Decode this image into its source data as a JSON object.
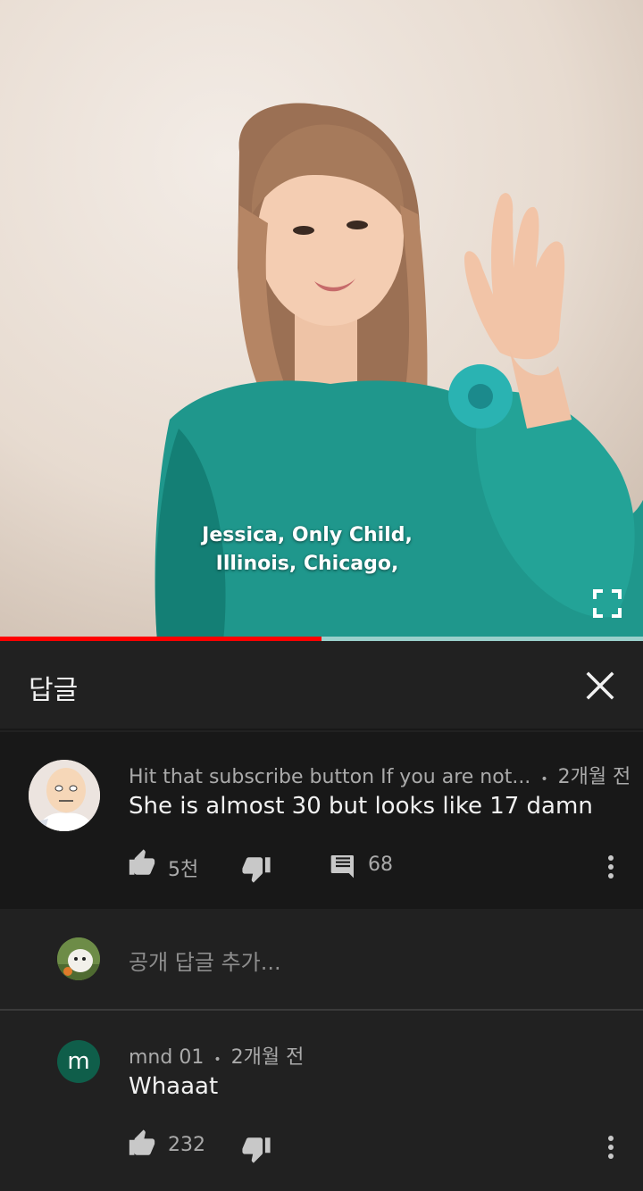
{
  "video": {
    "subtitle_lines": [
      "Jessica, Only Child,",
      "Illinois, Chicago,"
    ],
    "progress_fraction": 0.5,
    "colors": {
      "progress": "#ff0000",
      "track": "#e6e6e6"
    },
    "fullscreen_icon": "fullscreen-icon"
  },
  "replies_panel": {
    "title": "답글",
    "close_icon": "close-icon"
  },
  "parent_comment": {
    "author": "Hit that subscribe button If you are not...",
    "separator": "•",
    "time": "2개월 전",
    "text": "She is almost 30 but looks like 17 damn",
    "likes": "5천",
    "replies_count": "68",
    "icons": [
      "thumb-up-icon",
      "thumb-down-icon",
      "reply-icon",
      "more-vert-icon"
    ]
  },
  "add_reply": {
    "placeholder": "공개 답글 추가..."
  },
  "reply": {
    "avatar_letter": "m",
    "author": "mnd 01",
    "separator": "•",
    "time": "2개월 전",
    "text": "Whaaat",
    "likes": "232",
    "icons": [
      "thumb-up-icon",
      "thumb-down-icon",
      "more-vert-icon"
    ]
  }
}
